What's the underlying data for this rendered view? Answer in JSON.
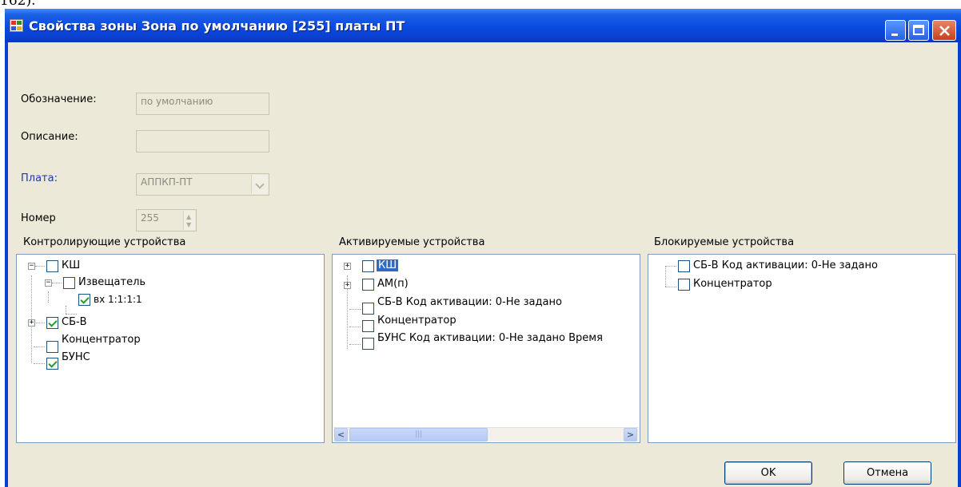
{
  "background_text": "162).",
  "window": {
    "title": "Свойства зоны Зона по умолчанию [255] платы ПТ"
  },
  "form": {
    "designation_label": "Обозначение:",
    "designation_value": "по умолчанию",
    "description_label": "Описание:",
    "description_value": "",
    "board_label": "Плата:",
    "board_value": "АППКП-ПТ",
    "number_label": "Номер",
    "number_value": "255"
  },
  "panels": {
    "controlling": {
      "title": "Контролирующие устройства",
      "items": [
        {
          "label": "КШ",
          "checked": false
        },
        {
          "label": "Извещатель",
          "checked": false
        },
        {
          "label": "вх 1:1:1:1",
          "checked": true
        },
        {
          "label": "СБ-В",
          "checked": true
        },
        {
          "label": "Концентратор",
          "checked": false
        },
        {
          "label": "БУНС",
          "checked": true
        }
      ]
    },
    "activated": {
      "title": "Активируемые устройства",
      "items": [
        {
          "label": "КШ",
          "checked": false,
          "selected": true
        },
        {
          "label": "АМ(п)",
          "checked": false
        },
        {
          "label": "СБ-В Код активации: 0-Не задано",
          "checked": false
        },
        {
          "label": "Концентратор",
          "checked": false
        },
        {
          "label": "БУНС Код активации: 0-Не задано Время",
          "checked": false
        }
      ]
    },
    "blocked": {
      "title": "Блокируемые устройства",
      "items": [
        {
          "label": "СБ-В Код активации: 0-Не задано",
          "checked": false
        },
        {
          "label": "Концентратор",
          "checked": false
        }
      ]
    }
  },
  "buttons": {
    "ok": "OK",
    "cancel": "Отмена"
  },
  "colors": {
    "titlebar": "#0a4ae0",
    "client_bg": "#ece9d8",
    "selection": "#316ac5",
    "check": "#21a121",
    "label_blue": "#1c3aa8"
  }
}
